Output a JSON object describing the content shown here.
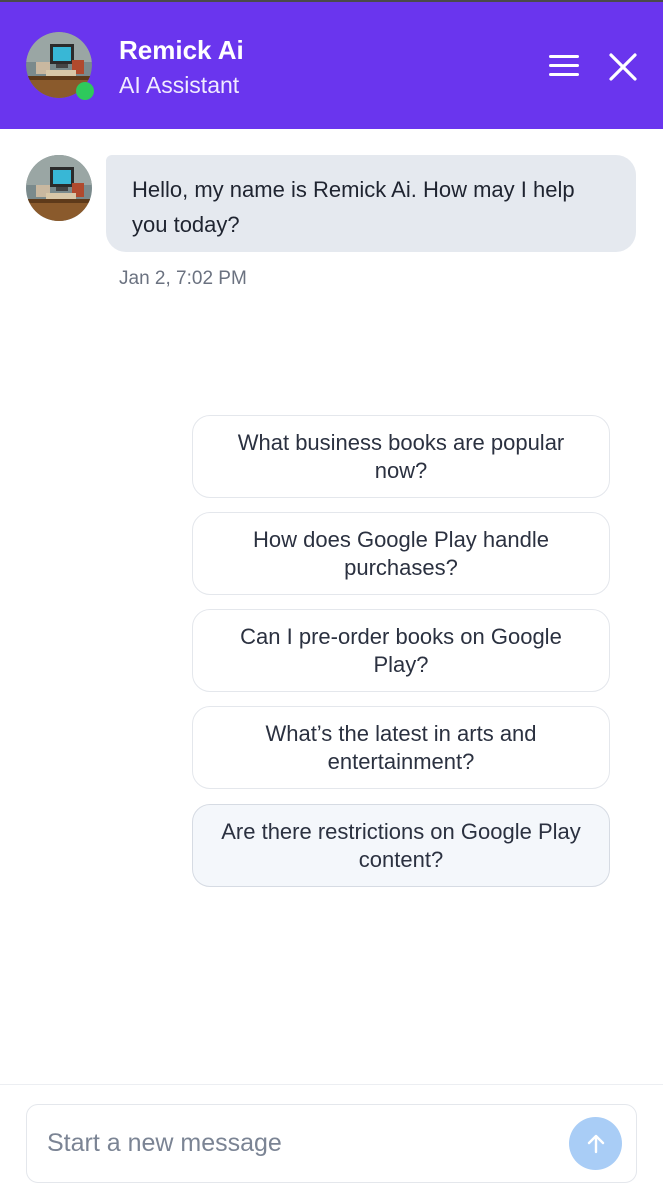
{
  "header": {
    "title": "Remick Ai",
    "subtitle": "AI Assistant",
    "background_color": "#6a35ee",
    "status_color": "#2ec95c",
    "menu_icon": "hamburger-icon",
    "close_icon": "close-icon"
  },
  "conversation": {
    "messages": [
      {
        "sender": "assistant",
        "text": "Hello, my name is Remick Ai. How may I help you today?",
        "timestamp": "Jan 2, 7:02 PM"
      }
    ]
  },
  "suggestions": [
    "What business books are popular now?",
    "How does Google Play handle purchases?",
    "Can I pre-order books on Google Play?",
    "What’s the latest in arts and entertainment?",
    "Are there restrictions on Google Play content?"
  ],
  "composer": {
    "placeholder": "Start a new message",
    "send_icon": "arrow-up-icon",
    "send_button_color": "#a9cdf6"
  }
}
